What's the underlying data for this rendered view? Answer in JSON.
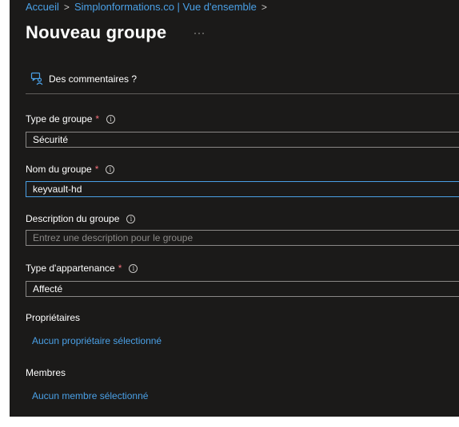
{
  "breadcrumb": {
    "items": [
      "Accueil",
      "Simplonformations.co | Vue d'ensemble"
    ],
    "separator": ">"
  },
  "page": {
    "title": "Nouveau groupe",
    "more_label": "···"
  },
  "feedback": {
    "label": "Des commentaires ?"
  },
  "form": {
    "group_type": {
      "label": "Type de groupe",
      "required": "*",
      "value": "Sécurité"
    },
    "group_name": {
      "label": "Nom du groupe",
      "required": "*",
      "value": "keyvault-hd"
    },
    "description": {
      "label": "Description du groupe",
      "placeholder": "Entrez une description pour le groupe"
    },
    "membership_type": {
      "label": "Type d'appartenance",
      "required": "*",
      "value": "Affecté"
    },
    "owners": {
      "label": "Propriétaires",
      "link": "Aucun propriétaire sélectionné"
    },
    "members": {
      "label": "Membres",
      "link": "Aucun membre sélectionné"
    }
  },
  "colors": {
    "background": "#1b1a19",
    "link": "#4aa0e6",
    "required": "#f1707b",
    "border": "#8a8886",
    "focus_border": "#4aa0e6"
  },
  "icons": [
    "feedback-icon",
    "info-icon",
    "more-icon",
    "chevron-right-icon"
  ]
}
